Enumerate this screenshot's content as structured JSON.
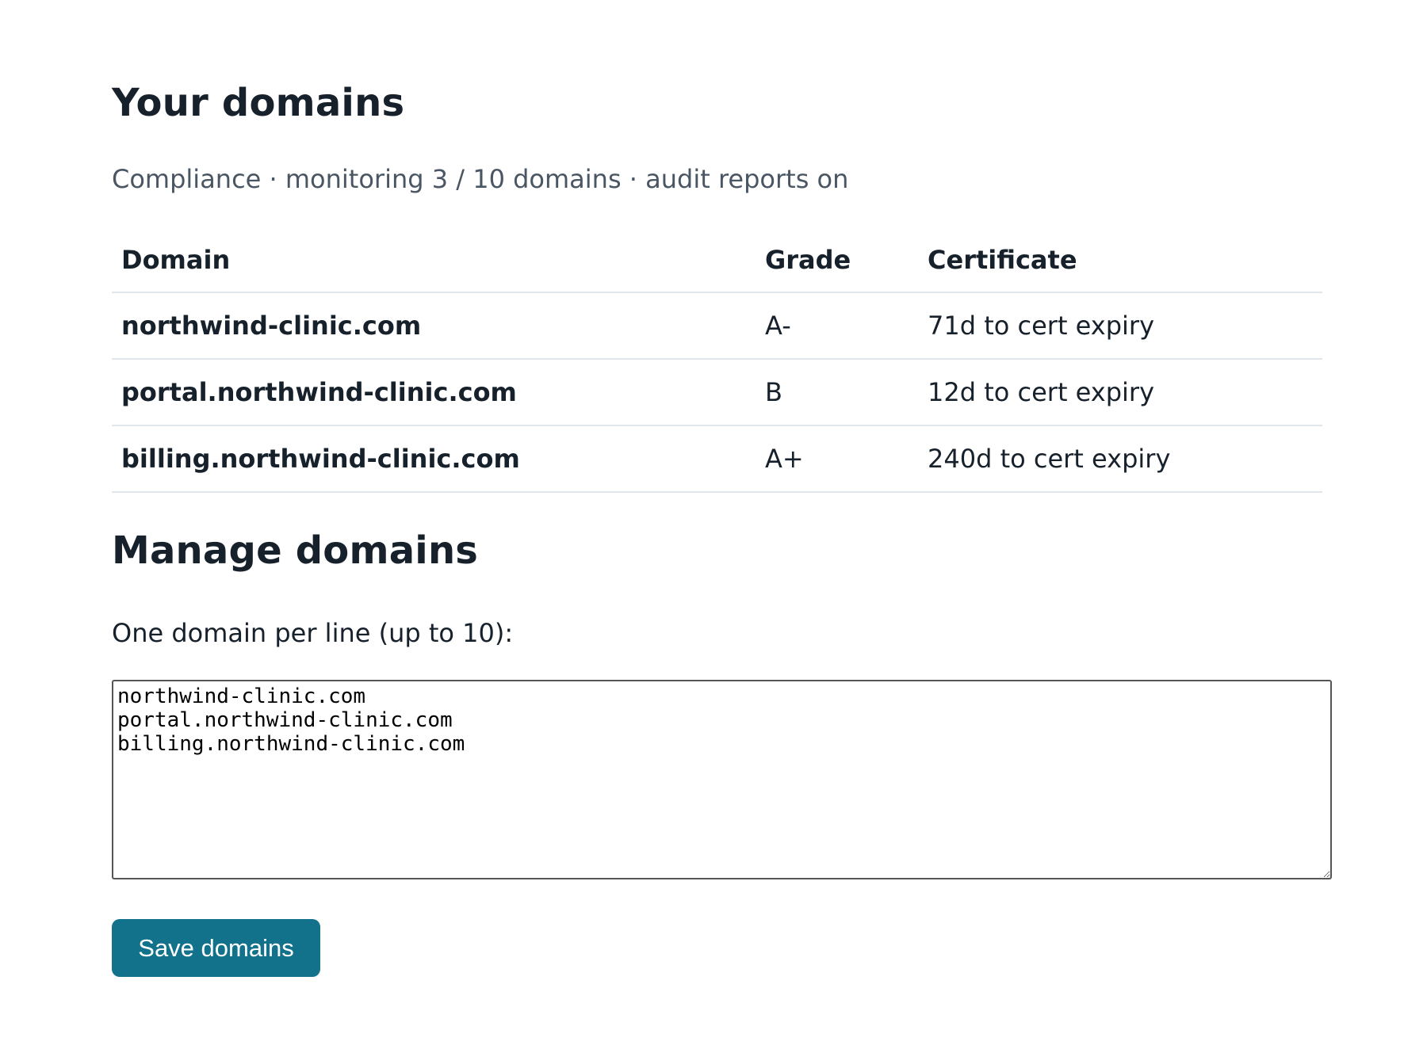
{
  "header": {
    "title": "Your domains",
    "subtitle": "Compliance · monitoring 3 / 10 domains · audit reports on"
  },
  "table": {
    "columns": [
      "Domain",
      "Grade",
      "Certificate"
    ],
    "rows": [
      {
        "domain": "northwind-clinic.com",
        "grade": "A-",
        "certificate": "71d to cert expiry"
      },
      {
        "domain": "portal.northwind-clinic.com",
        "grade": "B",
        "certificate": "12d to cert expiry"
      },
      {
        "domain": "billing.northwind-clinic.com",
        "grade": "A+",
        "certificate": "240d to cert expiry"
      }
    ]
  },
  "manage": {
    "title": "Manage domains",
    "label": "One domain per line (up to 10):",
    "textarea_value": "northwind-clinic.com\nportal.northwind-clinic.com\nbilling.northwind-clinic.com",
    "save_label": "Save domains"
  },
  "colors": {
    "text": "#17212b",
    "muted": "#4a5663",
    "divider": "#e1e6ec",
    "button": "#12728c"
  }
}
